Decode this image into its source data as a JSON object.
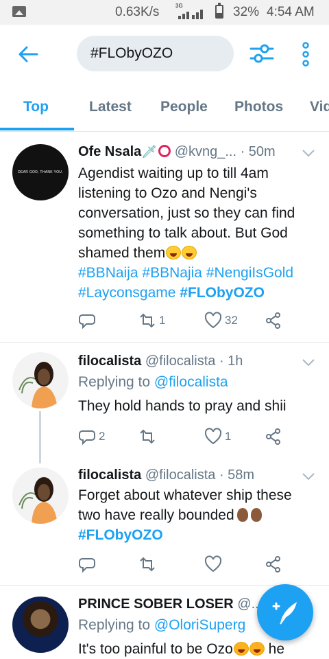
{
  "status_bar": {
    "speed": "0.63K/s",
    "network": "3G",
    "battery": "32%",
    "time": "4:54 AM"
  },
  "header": {
    "search_value": "#FLObyOZO"
  },
  "tabs": [
    {
      "label": "Top",
      "active": true
    },
    {
      "label": "Latest"
    },
    {
      "label": "People"
    },
    {
      "label": "Photos"
    },
    {
      "label": "Vid"
    }
  ],
  "tweets": [
    {
      "name": "Ofe Nsala",
      "handle": "@kvng_...",
      "time": "· 50m",
      "avatar_text": "DEAR GOD, THANK YOU.",
      "body_lines": [
        "Agendist waiting up to till 4am",
        "listening to Ozo and Nengi's",
        "conversation, just so they can find",
        "something to talk about. But God",
        "shamed them"
      ],
      "hashtags_line1": [
        "#BBNaija",
        "#BBNajia",
        "#NengiIsGold"
      ],
      "hashtags_line2": [
        "#Layconsgame",
        "#FLObyOZO"
      ],
      "retweets": "1",
      "likes": "32"
    },
    {
      "name": "filocalista",
      "handle": "@filocalista",
      "time": "· 1h",
      "replying_label": "Replying to",
      "replying_to": "@filocalista",
      "body": "They hold hands to pray and shii",
      "replies": "2",
      "likes": "1"
    },
    {
      "name": "filocalista",
      "handle": "@filocalista",
      "time": "· 58m",
      "body_lines": [
        "Forget about whatever ship these",
        "two have really bounded"
      ],
      "hashtag": "#FLObyOZO"
    },
    {
      "name": "PRINCE SOBER LOSER",
      "handle": "@...",
      "replying_label": "Replying to",
      "replying_to": "@OloriSuperg",
      "body_start": "It's too painful to be Ozo",
      "body_end": "he"
    }
  ]
}
